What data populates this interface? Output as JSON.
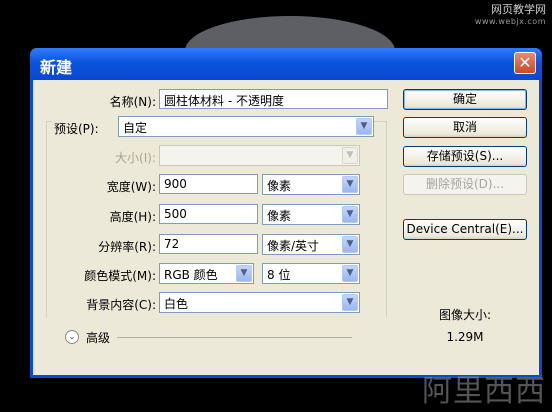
{
  "watermark": {
    "top": "网页教学网",
    "top_sub": "www.webjx.com",
    "bottom": "阿里西西"
  },
  "dialog": {
    "title": "新建",
    "close_glyph": "✕",
    "name": {
      "label": "名称(N):",
      "value": "圆柱体材料 - 不透明度"
    },
    "preset": {
      "label": "预设(P):",
      "value": "自定"
    },
    "size": {
      "label": "大小(I):",
      "value": ""
    },
    "width": {
      "label": "宽度(W):",
      "value": "900",
      "unit": "像素"
    },
    "height": {
      "label": "高度(H):",
      "value": "500",
      "unit": "像素"
    },
    "resolution": {
      "label": "分辨率(R):",
      "value": "72",
      "unit": "像素/英寸"
    },
    "color_mode": {
      "label": "颜色模式(M):",
      "value": "RGB 颜色",
      "depth": "8 位"
    },
    "background": {
      "label": "背景内容(C):",
      "value": "白色"
    },
    "advanced": {
      "label": "高级"
    },
    "buttons": {
      "ok": "确定",
      "cancel": "取消",
      "save_preset": "存储预设(S)...",
      "delete_preset": "删除预设(D)...",
      "device_central": "Device Central(E)..."
    },
    "image_size": {
      "label": "图像大小:",
      "value": "1.29M"
    }
  }
}
